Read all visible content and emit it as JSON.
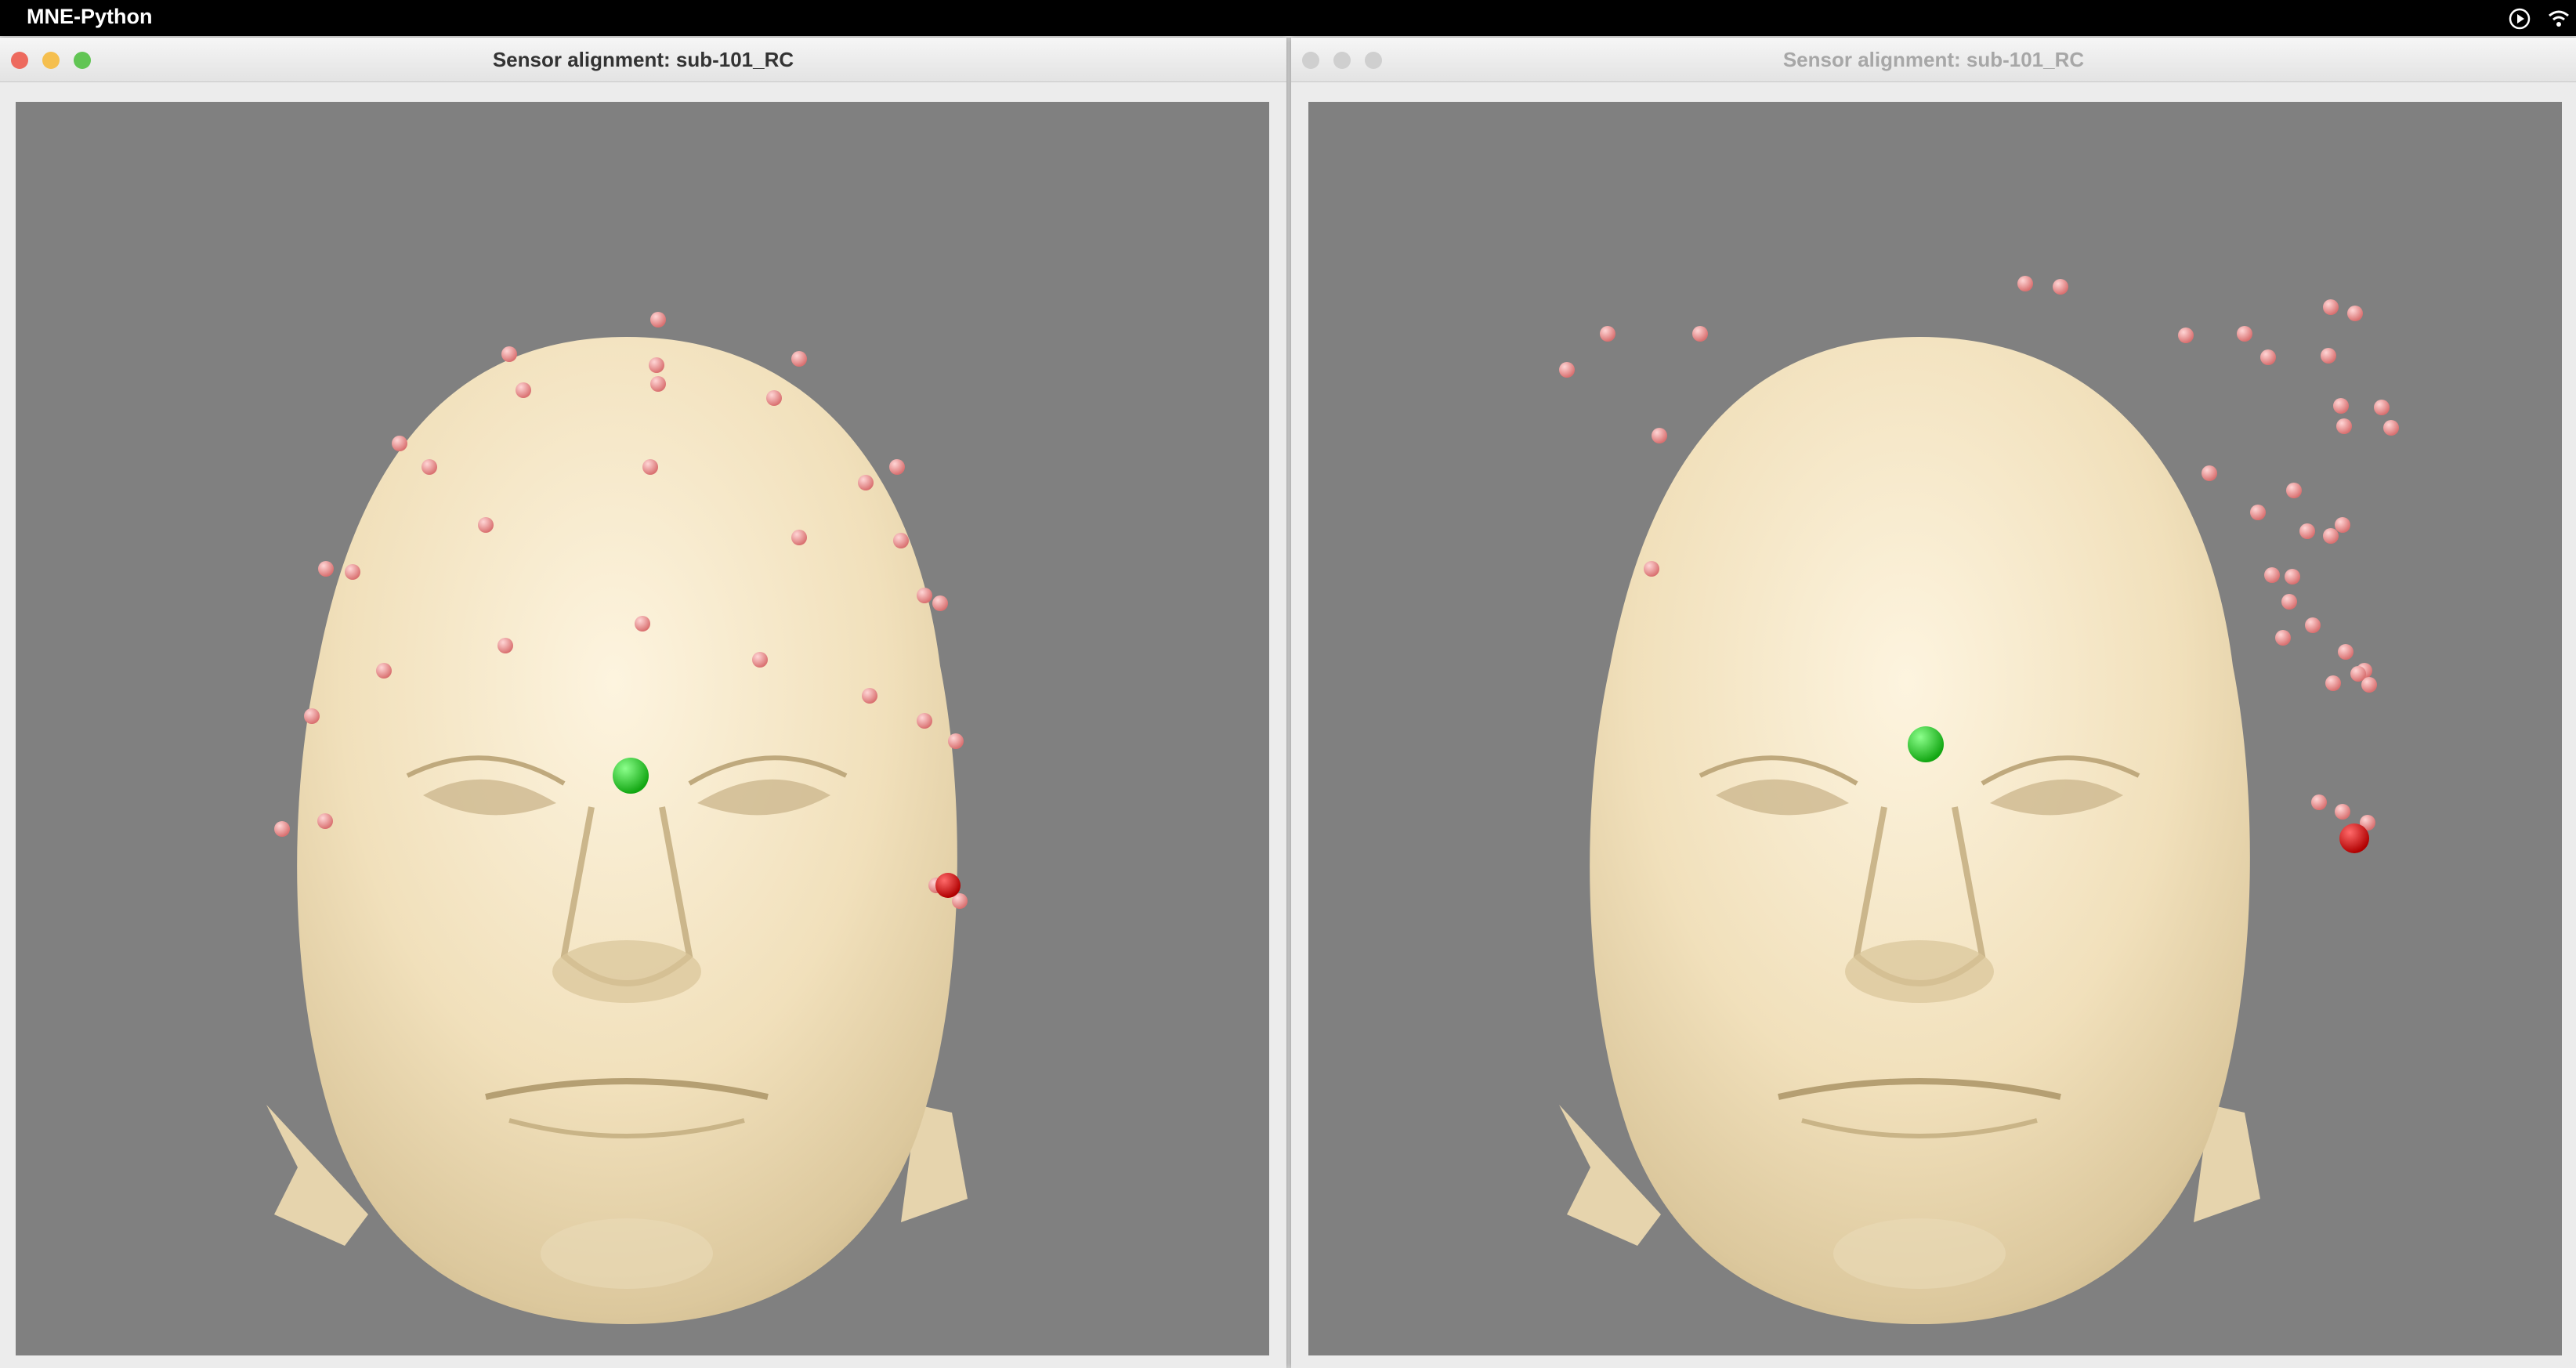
{
  "menubar": {
    "app_name": "MNE-Python",
    "icons": [
      "play-circle-icon",
      "wifi-icon"
    ]
  },
  "windows": [
    {
      "title": "Sensor alignment: sub-101_RC",
      "state": "active",
      "traffic_lights": {
        "close": "#ed6a5e",
        "minimize": "#f5bf4f",
        "zoom": "#61c554"
      }
    },
    {
      "title": "Sensor alignment: sub-101_RC",
      "state": "inactive",
      "traffic_lights": {
        "close": "#cfcfcf",
        "minimize": "#cfcfcf",
        "zoom": "#cfcfcf"
      }
    }
  ],
  "scene": {
    "background": "#808080",
    "head_color": "#f2e3c0",
    "sensor_color": "#f19a9a",
    "nasion_color": "#22cc22",
    "ear_fiducial_color": "#e00000"
  }
}
